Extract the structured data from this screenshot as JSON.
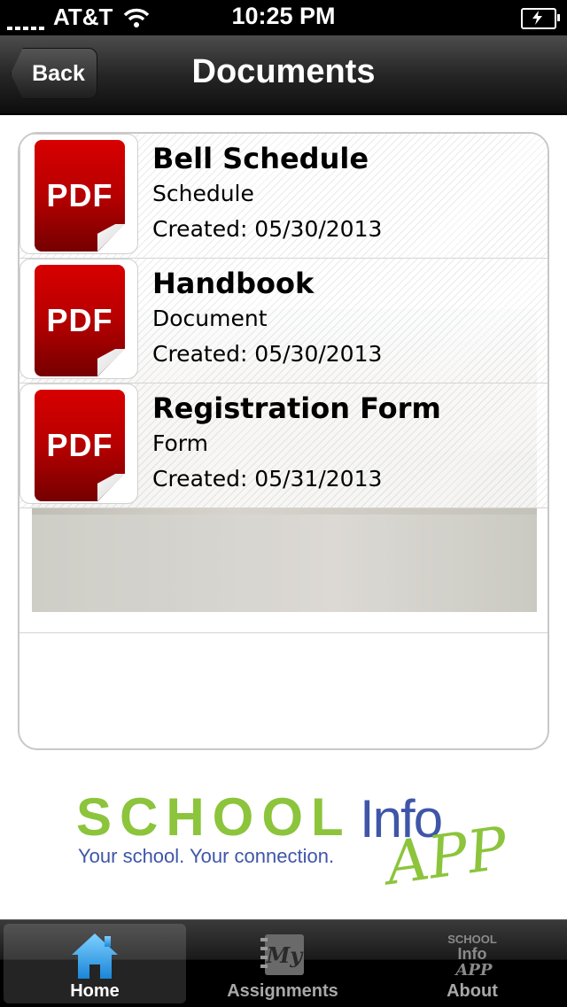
{
  "status_bar": {
    "carrier": "AT&T",
    "time": "10:25 PM"
  },
  "nav": {
    "back_label": "Back",
    "title": "Documents"
  },
  "documents": [
    {
      "title": "Bell Schedule",
      "type": "Schedule",
      "created": "Created: 05/30/2013",
      "icon_label": "PDF"
    },
    {
      "title": "Handbook",
      "type": "Document",
      "created": "Created: 05/30/2013",
      "icon_label": "PDF"
    },
    {
      "title": "Registration Form",
      "type": "Form",
      "created": "Created: 05/31/2013",
      "icon_label": "PDF"
    }
  ],
  "brand": {
    "school": "SCHOOL",
    "info": "Info",
    "app": "APP",
    "tagline": "Your school. Your connection."
  },
  "tabs": [
    {
      "label": "Home",
      "icon": "home-icon",
      "active": true
    },
    {
      "label": "Assignments",
      "icon": "my-assignments-icon",
      "active": false
    },
    {
      "label": "About",
      "icon": "school-info-app-icon",
      "active": false
    }
  ],
  "colors": {
    "pdf_red": "#c40000",
    "brand_green": "#8cc43c",
    "brand_blue": "#3f56a8",
    "tab_active_blue": "#3fa7f0"
  }
}
